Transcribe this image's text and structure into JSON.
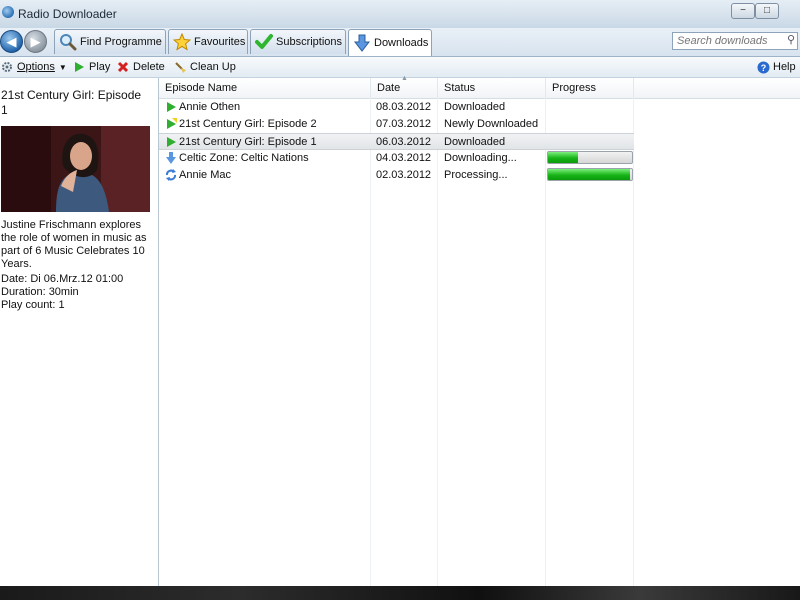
{
  "window": {
    "title": "Radio Downloader",
    "minimize_symbol": "−",
    "maximize_symbol": "□",
    "close_symbol": "✕"
  },
  "nav": {
    "back_icon": "back-arrow-icon",
    "forward_icon": "forward-arrow-icon"
  },
  "tabs": [
    {
      "label": "Find Programme",
      "icon": "magnifier-icon",
      "active": false
    },
    {
      "label": "Favourites",
      "icon": "star-icon",
      "active": false
    },
    {
      "label": "Subscriptions",
      "icon": "checkmark-icon",
      "active": false
    },
    {
      "label": "Downloads",
      "icon": "download-arrow-icon",
      "active": true
    }
  ],
  "search": {
    "placeholder": "Search downloads",
    "value": ""
  },
  "toolbar": {
    "options_label": "Options",
    "play_label": "Play",
    "delete_label": "Delete",
    "cleanup_label": "Clean Up",
    "help_label": "Help"
  },
  "info": {
    "title": "21st Century Girl: Episode 1",
    "description": "Justine Frischmann explores the role of women in music as part of 6 Music Celebrates 10 Years.",
    "date": "Date: Di 06.Mrz.12 01:00",
    "duration": "Duration: 30min",
    "play_count": "Play count: 1"
  },
  "list": {
    "columns": [
      "Episode Name",
      "Date",
      "Status",
      "Progress"
    ],
    "rows": [
      {
        "name": "Annie Othen",
        "date": "08.03.2012",
        "status": "Downloaded",
        "icon": "play-triangle-icon",
        "progress": null,
        "selected": false
      },
      {
        "name": "21st Century Girl: Episode 2",
        "date": "07.03.2012",
        "status": "Newly Downloaded",
        "icon": "new-play-triangle-icon",
        "progress": null,
        "selected": false
      },
      {
        "name": "21st Century Girl: Episode 1",
        "date": "06.03.2012",
        "status": "Downloaded",
        "icon": "play-triangle-icon",
        "progress": null,
        "selected": true
      },
      {
        "name": "Celtic Zone: Celtic Nations",
        "date": "04.03.2012",
        "status": "Downloading...",
        "icon": "download-arrow-icon",
        "progress": 0.36,
        "selected": false
      },
      {
        "name": "Annie Mac",
        "date": "02.03.2012",
        "status": "Processing...",
        "icon": "processing-arrows-icon",
        "progress": 0.98,
        "selected": false
      }
    ]
  },
  "colors": {
    "accent": "#1d5fa8",
    "progress_green": "#18b418",
    "selection": "#e2e5e8"
  }
}
